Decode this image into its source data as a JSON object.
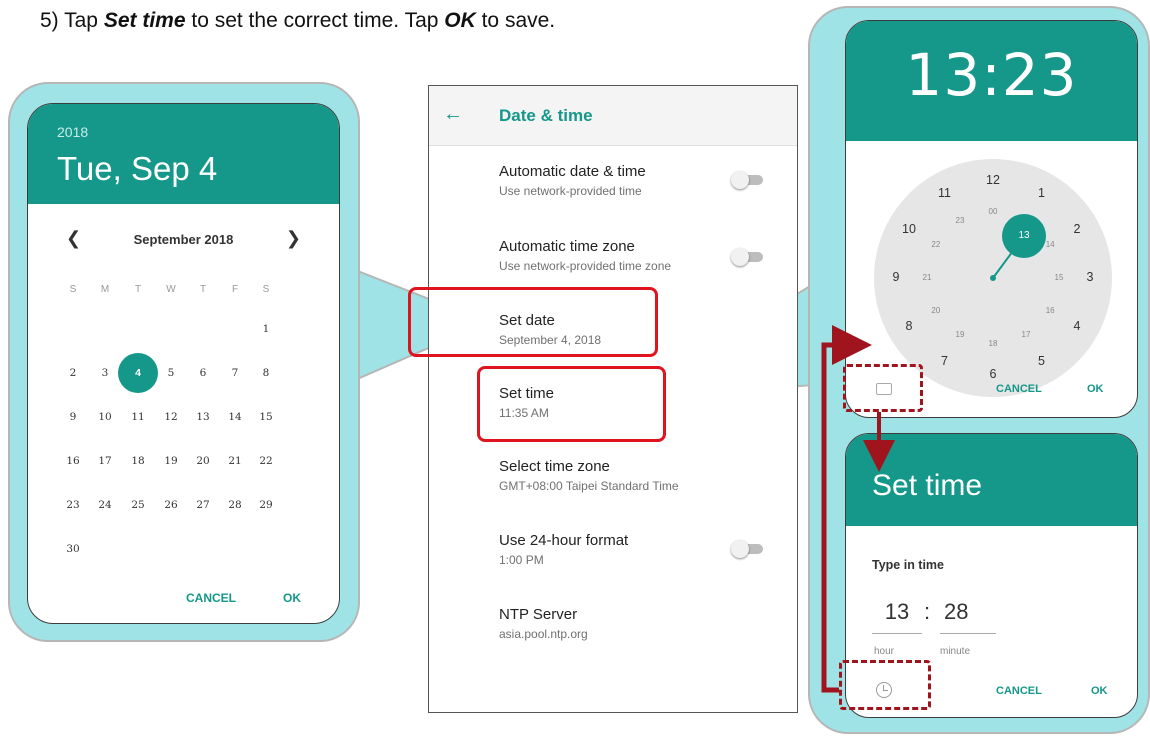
{
  "instruction": {
    "prefix": "5)  Tap ",
    "action1": "Set time",
    "middle": " to set the correct time. Tap ",
    "action2": "OK",
    "suffix": " to save."
  },
  "date_picker": {
    "year": "2018",
    "date": "Tue, Sep 4",
    "month_label": "September 2018",
    "prev_icon": "chevron-left-icon",
    "next_icon": "chevron-right-icon",
    "weekdays": [
      "S",
      "M",
      "T",
      "W",
      "T",
      "F",
      "S"
    ],
    "weeks": [
      [
        "",
        "",
        "",
        "",
        "",
        "",
        "1"
      ],
      [
        "2",
        "3",
        "4",
        "5",
        "6",
        "7",
        "8"
      ],
      [
        "9",
        "10",
        "11",
        "12",
        "13",
        "14",
        "15"
      ],
      [
        "16",
        "17",
        "18",
        "19",
        "20",
        "21",
        "22"
      ],
      [
        "23",
        "24",
        "25",
        "26",
        "27",
        "28",
        "29"
      ],
      [
        "30",
        "",
        "",
        "",
        "",
        "",
        ""
      ]
    ],
    "selected_day": "4",
    "cancel": "CANCEL",
    "ok": "OK"
  },
  "settings": {
    "back_icon": "arrow-left-icon",
    "title": "Date & time",
    "items": [
      {
        "title": "Automatic date & time",
        "sub": "Use network-provided time",
        "toggle": false
      },
      {
        "title": "Automatic time zone",
        "sub": "Use network-provided time zone",
        "toggle": false
      },
      {
        "title": "Set date",
        "sub": "September 4, 2018"
      },
      {
        "title": "Set time",
        "sub": "11:35 AM"
      },
      {
        "title": "Select time zone",
        "sub": "GMT+08:00 Taipei Standard Time"
      },
      {
        "title": "Use 24-hour format",
        "sub": "1:00 PM",
        "toggle": false
      },
      {
        "title": "NTP Server",
        "sub": "asia.pool.ntp.org"
      }
    ]
  },
  "clock_picker": {
    "time": "13:23",
    "outer_numbers": [
      "12",
      "1",
      "2",
      "3",
      "4",
      "5",
      "6",
      "7",
      "8",
      "9",
      "10",
      "11"
    ],
    "inner_numbers": [
      "00",
      "14",
      "15",
      "16",
      "17",
      "18",
      "19",
      "20",
      "21",
      "22",
      "23"
    ],
    "selected_hour": "13",
    "keyboard_icon": "keyboard-icon",
    "cancel": "CANCEL",
    "ok": "OK",
    "accent": "#15978a"
  },
  "type_in": {
    "title": "Set time",
    "label": "Type in time",
    "hour": "13",
    "colon": ":",
    "minute": "28",
    "hour_caption": "hour",
    "minute_caption": "minute",
    "clock_icon": "clock-icon",
    "cancel": "CANCEL",
    "ok": "OK"
  }
}
